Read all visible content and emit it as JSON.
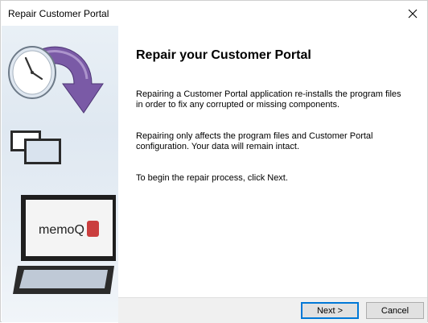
{
  "window": {
    "title": "Repair Customer Portal"
  },
  "sidebar": {
    "brand_logo_text": "memoQ",
    "icons": [
      "clock-arrow-icon",
      "windows-icon",
      "laptop-icon"
    ]
  },
  "content": {
    "heading": "Repair your Customer Portal",
    "paragraph_1": "Repairing a Customer Portal application re-installs the program files in order to fix any corrupted or missing components.",
    "paragraph_2": "Repairing only affects the program files and Customer Portal configuration. Your data will remain intact.",
    "paragraph_3": "To begin the repair process, click Next."
  },
  "buttons": {
    "next_label": "Next >",
    "cancel_label": "Cancel"
  },
  "colors": {
    "accent_border": "#0078d7",
    "arrow_purple": "#6f4f9a",
    "sidebar_bg": "#e3ebf3"
  }
}
